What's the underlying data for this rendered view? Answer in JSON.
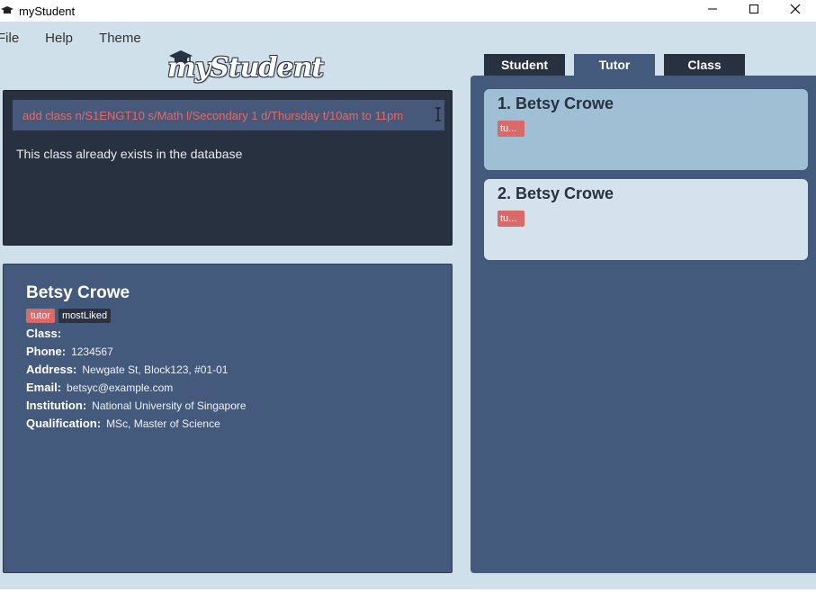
{
  "window": {
    "title": "myStudent"
  },
  "menu": [
    "File",
    "Help",
    "Theme"
  ],
  "logo": {
    "text": "myStudent"
  },
  "command": {
    "input_value": "add class n/S1ENGT10 s/Math l/Secondary 1 d/Thursday t/10am to 11pm",
    "result": "This class already exists in the database"
  },
  "detail": {
    "name": "Betsy Crowe",
    "tags": [
      "tutor",
      "mostLiked"
    ],
    "fields": [
      {
        "label": "Class:",
        "value": ""
      },
      {
        "label": "Phone:",
        "value": "1234567"
      },
      {
        "label": "Address:",
        "value": "Newgate St, Block123, #01-01"
      },
      {
        "label": "Email:",
        "value": "betsyc@example.com"
      },
      {
        "label": "Institution:",
        "value": "National University of Singapore"
      },
      {
        "label": "Qualification:",
        "value": "MSc, Master of Science"
      }
    ]
  },
  "tabs": [
    {
      "label": "Student",
      "active": false
    },
    {
      "label": "Tutor",
      "active": true
    },
    {
      "label": "Class",
      "active": false
    }
  ],
  "list": [
    {
      "name": "1. Betsy Crowe",
      "tag": "tu..."
    },
    {
      "name": "2. Betsy Crowe",
      "tag": "tu..."
    }
  ],
  "colors": {
    "background": "#cfe0ea",
    "dark_panel": "#283140",
    "mid_panel": "#445a7d",
    "tag_red": "#d86a6a",
    "card_selected": "#9fbfd4",
    "card_default": "#d4e2ec"
  }
}
